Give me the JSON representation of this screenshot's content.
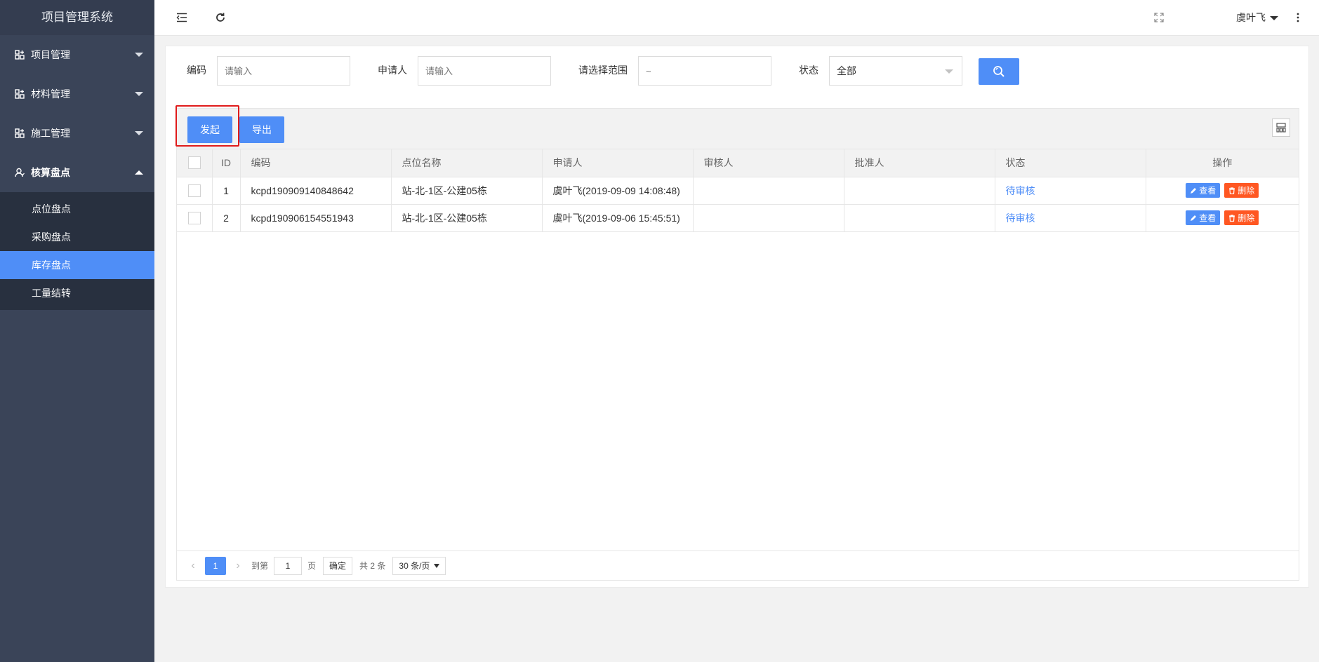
{
  "app": {
    "title": "项目管理系统"
  },
  "sidebar": {
    "groups": [
      {
        "label": "项目管理",
        "expanded": false
      },
      {
        "label": "材料管理",
        "expanded": false
      },
      {
        "label": "施工管理",
        "expanded": false
      },
      {
        "label": "核算盘点",
        "expanded": true
      }
    ],
    "subitems": [
      {
        "label": "点位盘点",
        "active": false
      },
      {
        "label": "采购盘点",
        "active": false
      },
      {
        "label": "库存盘点",
        "active": true
      },
      {
        "label": "工量结转",
        "active": false
      }
    ]
  },
  "header": {
    "user": "虞叶飞",
    "icons": [
      "menu-fold-icon",
      "refresh-icon",
      "fullscreen-icon",
      "more-vertical-icon"
    ]
  },
  "search": {
    "code_label": "编码",
    "code_placeholder": "请输入",
    "applicant_label": "申请人",
    "applicant_placeholder": "请输入",
    "range_label": "请选择范围",
    "range_placeholder": "~",
    "status_label": "状态",
    "status_value": "全部"
  },
  "toolbar": {
    "create_label": "发起",
    "export_label": "导出"
  },
  "table": {
    "headers": [
      "ID",
      "编码",
      "点位名称",
      "申请人",
      "审核人",
      "批准人",
      "状态",
      "操作"
    ],
    "rows": [
      {
        "id": "1",
        "code": "kcpd190909140848642",
        "location": "站-北-1区-公建05栋",
        "applicant": "虞叶飞(2019-09-09 14:08:48)",
        "reviewer": "",
        "approver": "",
        "status": "待审核"
      },
      {
        "id": "2",
        "code": "kcpd190906154551943",
        "location": "站-北-1区-公建05栋",
        "applicant": "虞叶飞(2019-09-06 15:45:51)",
        "reviewer": "",
        "approver": "",
        "status": "待审核"
      }
    ],
    "view_label": "查看",
    "delete_label": "删除"
  },
  "pager": {
    "current_page": "1",
    "goto_label": "到第",
    "goto_value": "1",
    "page_unit": "页",
    "confirm_label": "确定",
    "total_label": "共 2 条",
    "page_size": "30 条/页"
  },
  "colors": {
    "primary": "#4f8ef7",
    "danger": "#ff5722",
    "sidebar": "#3a4458",
    "highlight": "#e01b1b"
  }
}
